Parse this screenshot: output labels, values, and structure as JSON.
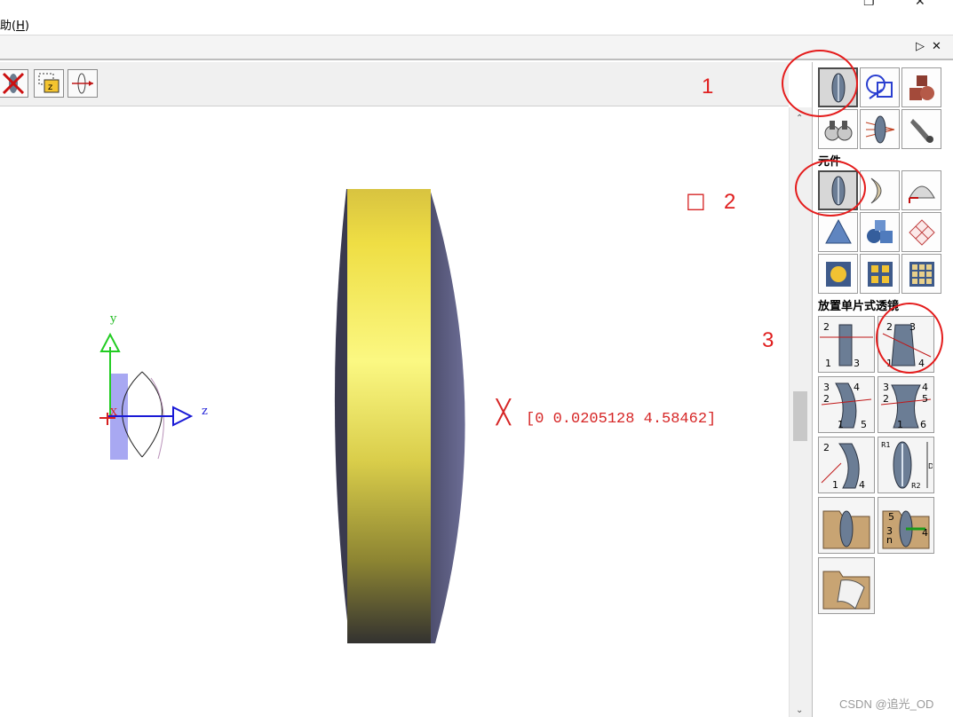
{
  "window": {
    "restore_glyph": "❐",
    "close_glyph": "✕"
  },
  "menu": {
    "help_prefix": "助(",
    "help_key": "H",
    "help_suffix": ")"
  },
  "panel_header": {
    "pin_glyph": "▷",
    "close_glyph": "✕"
  },
  "toolbar": {
    "buttons": [
      "delete-element",
      "z-axis-frame",
      "lens-ray-tool"
    ]
  },
  "viewport": {
    "axis_labels": {
      "y": "y",
      "z": "z",
      "x": "X"
    },
    "cursor_glyph": "╳",
    "coordinate_readout": "[0 0.0205128 4.58462]",
    "square_marker": "□"
  },
  "palette": {
    "section_components": "元件",
    "section_place_lens": "放置单片式透镜",
    "row1": [
      "lens-icon",
      "shape-select-icon",
      "solids-icon"
    ],
    "row2": [
      "binoculars-icon",
      "ray-lens-icon",
      "wrench-icon"
    ],
    "row3": [
      "single-lens-icon",
      "mirror-curve-icon",
      "dome-icon"
    ],
    "row4": [
      "prism-icon",
      "shapes-3d-icon",
      "grid-diamond-icon"
    ],
    "row5": [
      "aperture-single-icon",
      "aperture-quad-icon",
      "aperture-multi-icon"
    ],
    "lens_tools": [
      {
        "name": "plano-lens-2-3",
        "nums": [
          "2",
          "1",
          "3"
        ]
      },
      {
        "name": "wedge-lens-2-3-4",
        "nums": [
          "2",
          "3",
          "1",
          "4"
        ]
      },
      {
        "name": "meniscus-lens-5",
        "nums": [
          "3",
          "4",
          "2",
          "1",
          "5"
        ]
      },
      {
        "name": "bicon-lens-6",
        "nums": [
          "3",
          "4",
          "2",
          "5",
          "1",
          "6"
        ]
      },
      {
        "name": "curved-lens-4",
        "nums": [
          "2",
          "1",
          "4"
        ]
      },
      {
        "name": "radius-lens",
        "nums": [
          "R1",
          "R2",
          "D"
        ]
      },
      {
        "name": "folder-lens-open",
        "nums": []
      },
      {
        "name": "folder-lens-tagged",
        "nums": [
          "5",
          "3",
          "n",
          "4"
        ]
      },
      {
        "name": "folder-open",
        "nums": []
      }
    ]
  },
  "annotations": {
    "one": "1",
    "two": "2",
    "three": "3"
  },
  "watermark": "CSDN @追光_OD",
  "colors": {
    "annotation_red": "#e41c1c",
    "lens_yellow": "#f2e44a",
    "lens_side": "#5f6185",
    "axis_y": "#22cc22",
    "axis_z": "#1a1ad6",
    "axis_x": "#d62020"
  }
}
